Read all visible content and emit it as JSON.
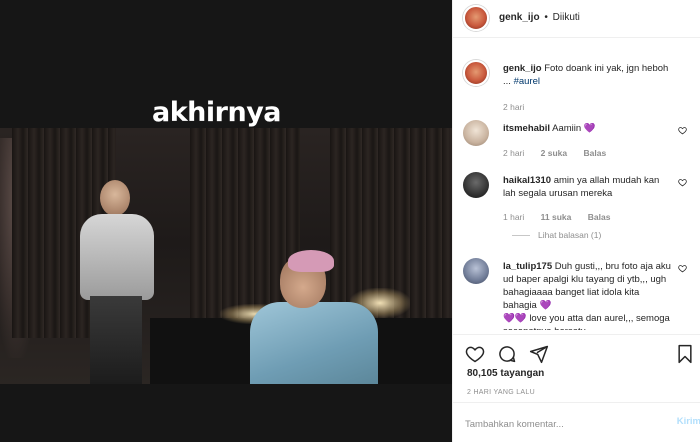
{
  "media": {
    "caption_overlay": "akhirnya"
  },
  "header": {
    "username": "genk_ijo",
    "separator": "•",
    "follow_status": "Diikuti"
  },
  "post": {
    "username": "genk_ijo",
    "caption": "Foto doank ini yak, jgn heboh ...",
    "hashtag": "#aurel",
    "time": "2 hari"
  },
  "comments": [
    {
      "username": "itsmehabil",
      "text": "Aamiin",
      "emoji": "💜",
      "time": "2 hari",
      "likes": "2 suka",
      "reply": "Balas"
    },
    {
      "username": "haikal1310",
      "text": "amin ya allah mudah kan lah segala urusan mereka",
      "time": "1 hari",
      "likes": "11 suka",
      "reply": "Balas",
      "view_replies": "Lihat balasan (1)"
    },
    {
      "username": "la_tulip175",
      "text": "Duh gusti,,, bru foto aja aku ud baper apalgi klu tayang di ytb,,, ugh bahagiaaaa banget liat idola kita bahagia",
      "emoji": "💜",
      "text_2": "love you atta dan aurel,,, semoga secepatnya bersatu",
      "emoji_prefix": "💜💜"
    }
  ],
  "actions": {
    "like_icon": "heart-icon",
    "comment_icon": "comment-icon",
    "share_icon": "share-icon",
    "save_icon": "bookmark-icon"
  },
  "stats": {
    "views": "80,105 tayangan",
    "posted": "2 HARI YANG LALU"
  },
  "add_comment": {
    "placeholder": "Tambahkan komentar...",
    "send_label": "Kirim"
  },
  "colors": {
    "link": "#00376b",
    "muted": "#8e8e8e",
    "send_disabled": "#b2dffc",
    "border": "#efefef"
  }
}
